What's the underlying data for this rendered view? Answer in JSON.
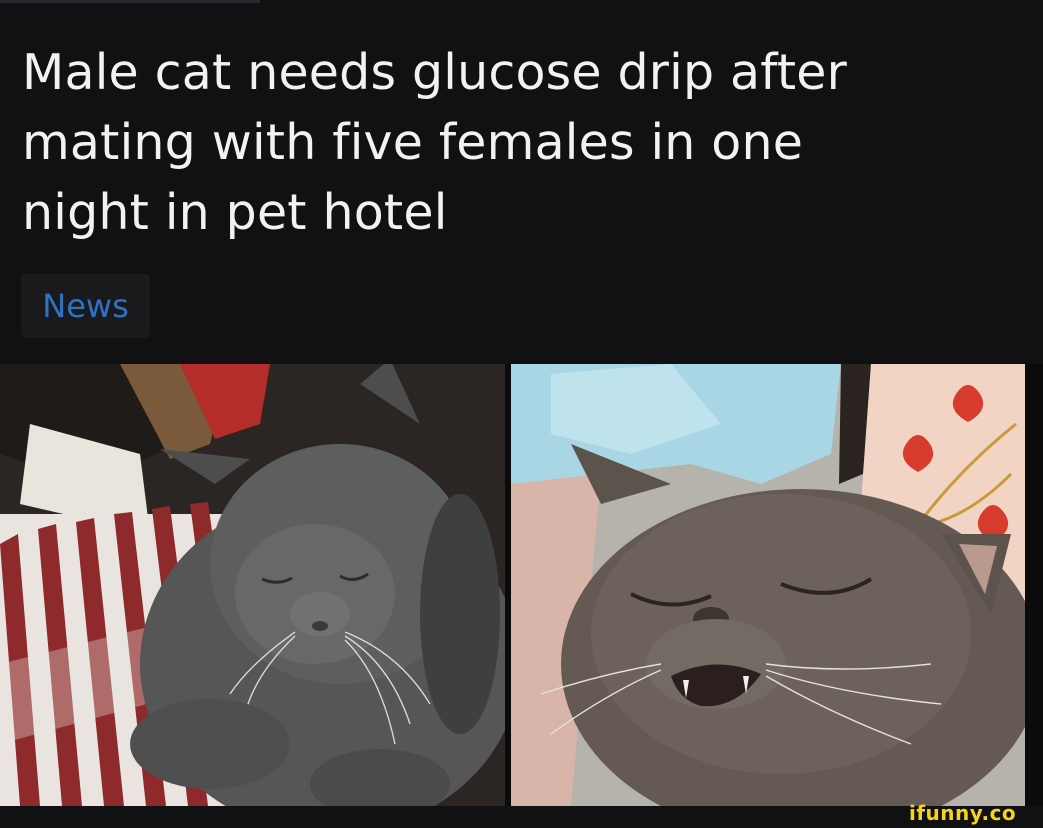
{
  "article": {
    "title_lines": [
      "Male cat needs glucose drip after",
      "mating with five females in one",
      "night in pet hotel"
    ],
    "tag_label": "News"
  },
  "photos": [
    {
      "subject": "grey cat sleeping on striped blanket"
    },
    {
      "subject": "grey cat face with eyes closed and teeth showing"
    }
  ],
  "watermark": {
    "text": "ifunny.co"
  },
  "colors": {
    "background": "#111113",
    "headline": "#f2f2f2",
    "tag_text": "#2d73c4",
    "tag_bg": "#1a1a1d",
    "watermark": "#f5d21c"
  }
}
